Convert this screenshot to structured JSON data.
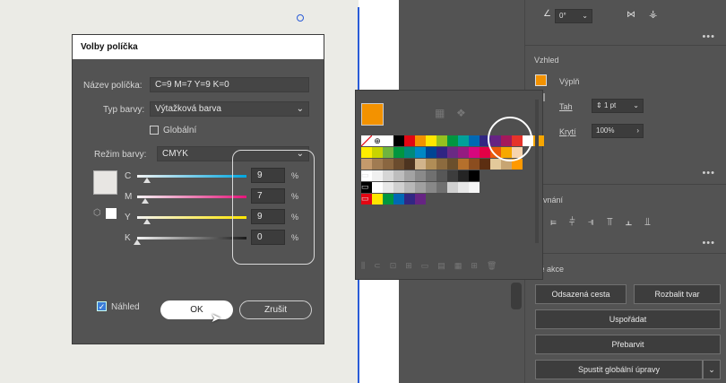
{
  "dialog": {
    "title": "Volby políčka",
    "name_label": "Název políčka:",
    "name_value": "C=9 M=7 Y=9 K=0",
    "type_label": "Typ barvy:",
    "type_value": "Výtažková barva",
    "global_label": "Globální",
    "global_checked": false,
    "mode_label": "Režim barvy:",
    "mode_value": "CMYK",
    "channels": [
      {
        "label": "C",
        "value": "9",
        "unit": "%",
        "level": 0.09
      },
      {
        "label": "M",
        "value": "7",
        "unit": "%",
        "level": 0.07
      },
      {
        "label": "Y",
        "value": "9",
        "unit": "%",
        "level": 0.09
      },
      {
        "label": "K",
        "value": "0",
        "unit": "%",
        "level": 0.0
      }
    ],
    "preview_label": "Náhled",
    "preview_checked": true,
    "ok_label": "OK",
    "cancel_label": "Zrušit"
  },
  "props": {
    "angle_value": "0°",
    "view_title": "Vzhled",
    "fill_label": "Výplň",
    "stroke_label": "Tah",
    "stroke_value": "1 pt",
    "opacity_label": "Krytí",
    "opacity_value": "100%",
    "align_title": "rovnání",
    "actions_title": "ké akce",
    "btn_offset": "Odsazená cesta",
    "btn_expand": "Rozbalit tvar",
    "btn_arrange": "Uspořádat",
    "btn_recolor": "Přebarvit",
    "btn_global_edit": "Spustit globální úpravy",
    "more": "•••"
  },
  "colors": {
    "accent_orange": "#f39200",
    "dialog_bg": "#535353",
    "guide_blue": "#2a5bd7"
  }
}
